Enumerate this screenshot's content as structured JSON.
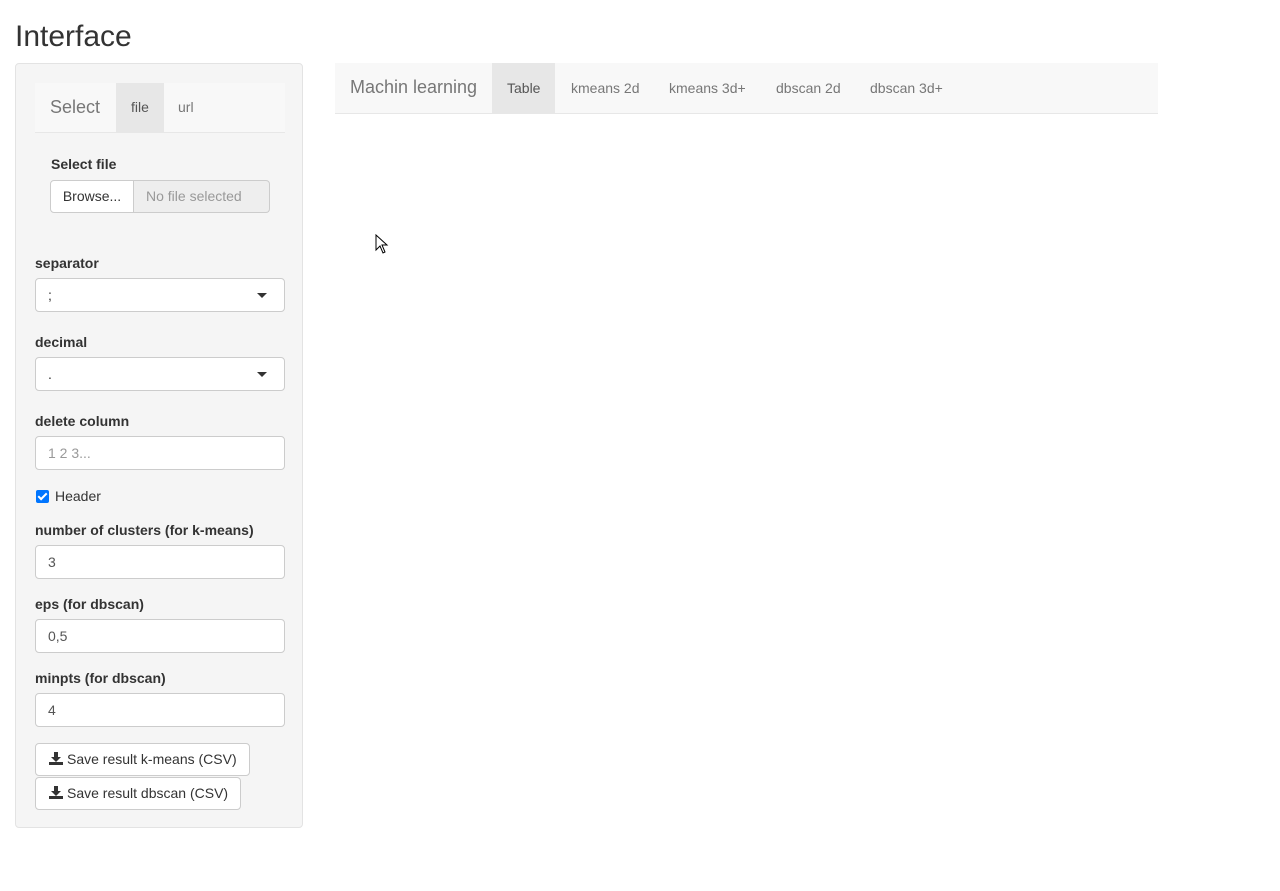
{
  "page": {
    "title": "Interface"
  },
  "sidebar": {
    "nav": {
      "brand": "Select",
      "tabs": [
        {
          "label": "file",
          "active": true
        },
        {
          "label": "url",
          "active": false
        }
      ]
    },
    "file_input": {
      "label": "Select file",
      "button_label": "Browse...",
      "placeholder": "No file selected"
    },
    "separator": {
      "label": "separator",
      "value": ";"
    },
    "decimal": {
      "label": "decimal",
      "value": "."
    },
    "delete_column": {
      "label": "delete column",
      "placeholder": "1 2 3..."
    },
    "header_checkbox": {
      "label": "Header",
      "checked": true
    },
    "clusters": {
      "label": "number of clusters (for k-means)",
      "value": "3"
    },
    "eps": {
      "label": "eps (for dbscan)",
      "value": "0,5"
    },
    "minpts": {
      "label": "minpts (for dbscan)",
      "value": "4"
    },
    "buttons": {
      "save_kmeans": "Save result k-means (CSV)",
      "save_dbscan": "Save result dbscan (CSV)"
    }
  },
  "main": {
    "nav": {
      "brand": "Machin learning",
      "tabs": [
        {
          "label": "Table",
          "active": true
        },
        {
          "label": "kmeans 2d",
          "active": false
        },
        {
          "label": "kmeans 3d+",
          "active": false
        },
        {
          "label": "dbscan 2d",
          "active": false
        },
        {
          "label": "dbscan 3d+",
          "active": false
        }
      ]
    }
  },
  "colors": {
    "accent_checkbox": "#0075ff",
    "sidebar_bg": "#f5f5f5",
    "navbar_bg": "#f8f8f8",
    "active_tab_bg": "#e7e7e7"
  },
  "icons": {
    "download": "download-icon",
    "caret": "chevron-down-icon",
    "cursor": "mouse-pointer-icon"
  }
}
